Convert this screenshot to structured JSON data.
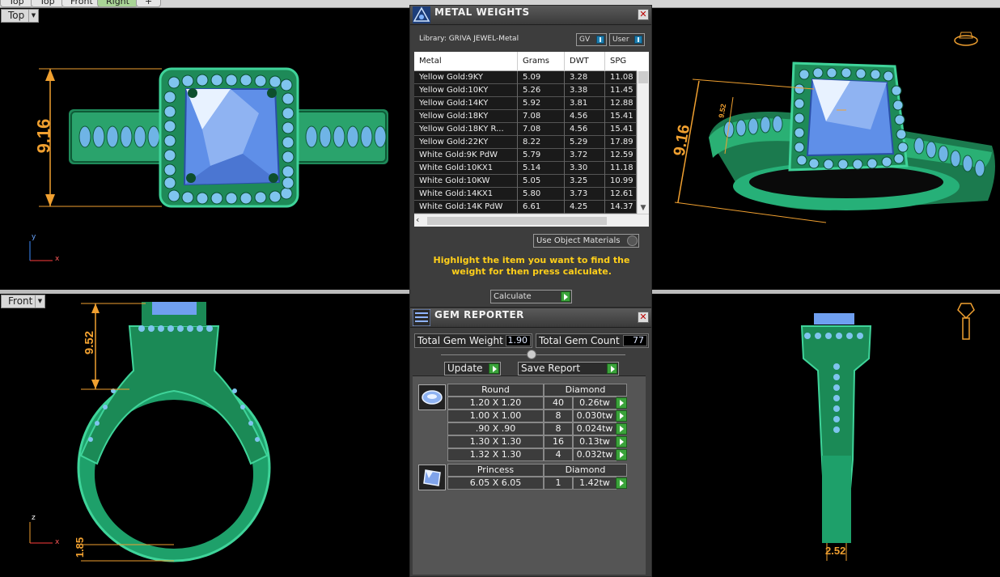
{
  "viewport_tabs": [
    "Top",
    "Top",
    "Front",
    "Right"
  ],
  "viewports": {
    "top_left": {
      "label": "Top",
      "dimension": "9.16",
      "axis_y": "y",
      "axis_x": "x"
    },
    "top_right": {
      "dimension": "9.16",
      "dimension_small": "9.52"
    },
    "bottom_left": {
      "label": "Front",
      "dimension_top": "9.52",
      "dimension_bottom": "1.85",
      "axis_z": "z",
      "axis_x": "x"
    },
    "bottom_right": {
      "dimension": "2.52"
    }
  },
  "metal_weights": {
    "title": "METAL WEIGHTS",
    "library": "Library: GRIVA JEWEL-Metal",
    "toggle_gv": "GV",
    "toggle_user": "User",
    "columns": [
      "Metal",
      "Grams",
      "DWT",
      "SPG"
    ],
    "rows": [
      [
        "Yellow Gold:9KY",
        "5.09",
        "3.28",
        "11.08"
      ],
      [
        "Yellow Gold:10KY",
        "5.26",
        "3.38",
        "11.45"
      ],
      [
        "Yellow Gold:14KY",
        "5.92",
        "3.81",
        "12.88"
      ],
      [
        "Yellow Gold:18KY",
        "7.08",
        "4.56",
        "15.41"
      ],
      [
        "Yellow Gold:18KY R...",
        "7.08",
        "4.56",
        "15.41"
      ],
      [
        "Yellow Gold:22KY",
        "8.22",
        "5.29",
        "17.89"
      ],
      [
        "White Gold:9K PdW",
        "5.79",
        "3.72",
        "12.59"
      ],
      [
        "White Gold:10KX1",
        "5.14",
        "3.30",
        "11.18"
      ],
      [
        "White Gold:10KW",
        "5.05",
        "3.25",
        "10.99"
      ],
      [
        "White Gold:14KX1",
        "5.80",
        "3.73",
        "12.61"
      ],
      [
        "White Gold:14K PdW",
        "6.61",
        "4.25",
        "14.37"
      ]
    ],
    "use_object_materials": "Use Object Materials",
    "hint": "Highlight the item you want to find the weight for then press calculate.",
    "calculate": "Calculate"
  },
  "gem_reporter": {
    "title": "GEM REPORTER",
    "total_weight_label": "Total Gem Weight",
    "total_weight_value": "1.90",
    "total_count_label": "Total Gem Count",
    "total_count_value": "77",
    "update": "Update",
    "save_report": "Save Report",
    "groups": [
      {
        "shape": "Round",
        "stone": "Diamond",
        "rows": [
          [
            "1.20 X 1.20",
            "40",
            "0.26tw"
          ],
          [
            "1.00 X 1.00",
            "8",
            "0.030tw"
          ],
          [
            ".90 X .90",
            "8",
            "0.024tw"
          ],
          [
            "1.30 X 1.30",
            "16",
            "0.13tw"
          ],
          [
            "1.32 X 1.30",
            "4",
            "0.032tw"
          ]
        ]
      },
      {
        "shape": "Princess",
        "stone": "Diamond",
        "rows": [
          [
            "6.05 X 6.05",
            "1",
            "1.42tw"
          ]
        ]
      }
    ]
  }
}
